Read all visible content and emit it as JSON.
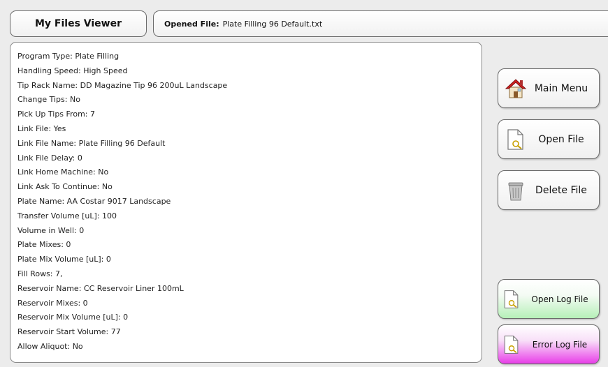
{
  "header": {
    "title": "My Files Viewer",
    "opened_label": "Opened File:",
    "opened_file": "Plate Filling 96 Default.txt"
  },
  "file_lines": [
    "Program Type: Plate Filling",
    "Handling Speed: High Speed",
    "Tip Rack Name: DD Magazine Tip 96 200uL Landscape",
    "Change Tips: No",
    "Pick Up Tips From: 7",
    "Link File: Yes",
    "Link File Name: Plate Filling 96 Default",
    "Link File Delay: 0",
    "Link Home Machine: No",
    "Link Ask To Continue: No",
    "Plate Name: AA Costar 9017 Landscape",
    "Transfer Volume [uL]: 100",
    "Volume in Well: 0",
    "Plate Mixes: 0",
    "Plate Mix Volume [uL]: 0",
    "Fill Rows: 7,",
    "Reservoir Name: CC Reservoir Liner 100mL",
    "Reservoir Mixes: 0",
    "Reservoir Mix Volume [uL]: 0",
    "Reservoir Start Volume: 77",
    "Allow Aliquot: No"
  ],
  "buttons": {
    "main_menu": "Main Menu",
    "open_file": "Open File",
    "delete_file": "Delete File",
    "open_log_file": "Open Log File",
    "error_log_file": "Error Log File"
  },
  "icons": {
    "main_menu": "house-icon",
    "open_file": "document-search-icon",
    "delete_file": "trash-can-icon",
    "open_log_file": "document-search-icon",
    "error_log_file": "document-search-icon"
  },
  "colors": {
    "log_button_gradient": "#b6f0b8",
    "error_button_gradient": "#e83ee8"
  }
}
